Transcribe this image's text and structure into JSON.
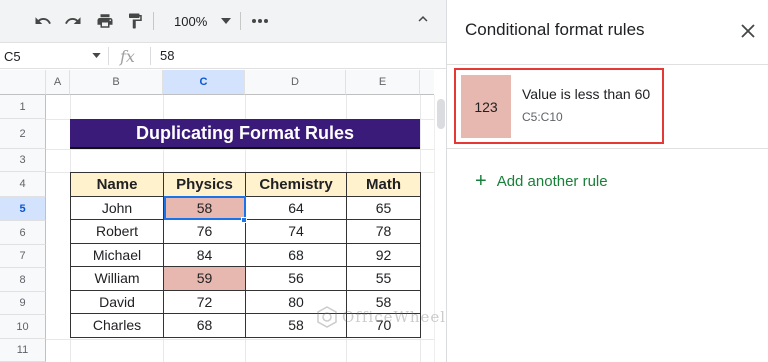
{
  "toolbar": {
    "zoom": "100%",
    "icons": [
      "undo-icon",
      "redo-icon",
      "print-icon",
      "paint-format-icon",
      "more-icon",
      "collapse-icon"
    ]
  },
  "formula_bar": {
    "cell_ref": "C5",
    "fx": "fx",
    "value": "58"
  },
  "columns": [
    "A",
    "B",
    "C",
    "D",
    "E"
  ],
  "rows": [
    "1",
    "2",
    "3",
    "4",
    "5",
    "6",
    "7",
    "8",
    "9",
    "10",
    "11"
  ],
  "sheet": {
    "title": "Duplicating Format Rules",
    "headers": [
      "Name",
      "Physics",
      "Chemistry",
      "Math"
    ],
    "data": [
      [
        "John",
        "58",
        "64",
        "65"
      ],
      [
        "Robert",
        "76",
        "74",
        "78"
      ],
      [
        "Michael",
        "84",
        "68",
        "92"
      ],
      [
        "William",
        "59",
        "56",
        "55"
      ],
      [
        "David",
        "72",
        "80",
        "58"
      ],
      [
        "Charles",
        "68",
        "58",
        "70"
      ]
    ]
  },
  "panel": {
    "title": "Conditional format rules",
    "rule": {
      "preview": "123",
      "description": "Value is less than 60",
      "range": "C5:C10",
      "color": "#e6b8af"
    },
    "add_rule": "Add another rule"
  },
  "watermark": "OfficeWheel",
  "colors": {
    "title_bg": "#3b1b7a",
    "header_bg": "#fff2cc",
    "highlight": "#e6b8af",
    "selection": "#1a73e8",
    "add_rule": "#188038",
    "rule_border": "#e53935"
  }
}
